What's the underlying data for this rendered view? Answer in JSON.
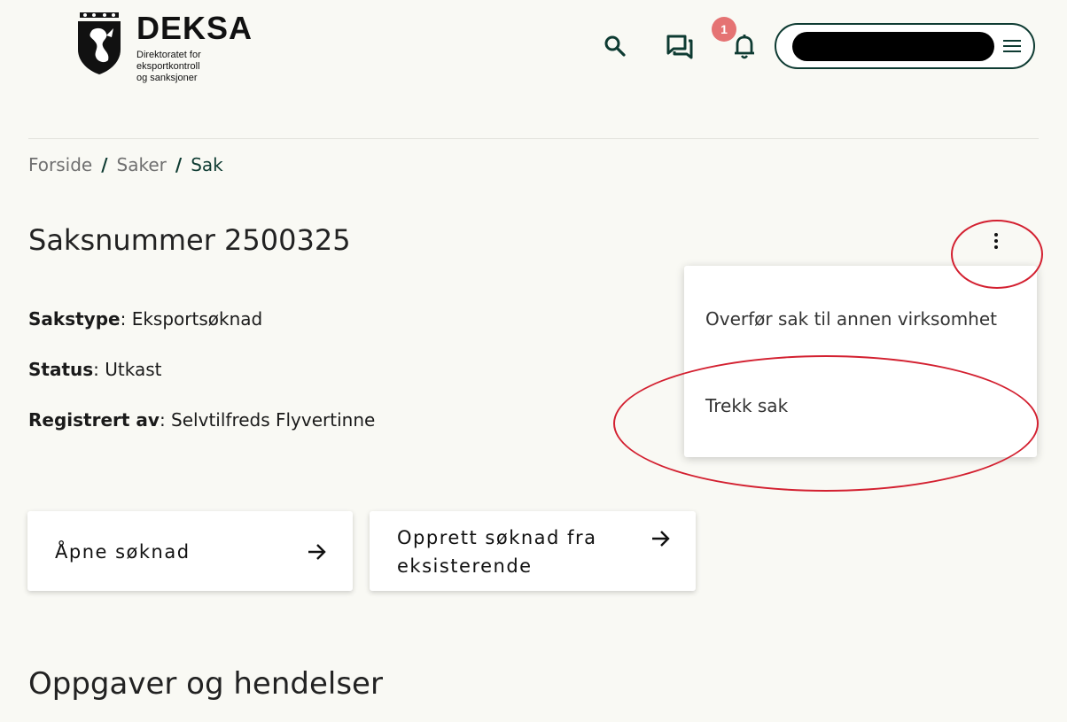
{
  "header": {
    "logo_name": "DEKSA",
    "logo_sub_line1": "Direktoratet for",
    "logo_sub_line2": "eksportkontroll",
    "logo_sub_line3": "og sanksjoner",
    "notification_count": "1",
    "icons": [
      "search-icon",
      "messages-icon",
      "bell-icon",
      "menu-icon"
    ],
    "accent_color": "#0e3b32",
    "badge_color": "#e57373"
  },
  "breadcrumb": {
    "items": [
      "Forside",
      "Saker",
      "Sak"
    ],
    "separator": "/"
  },
  "case": {
    "title": "Saksnummer 2500325",
    "type_label": "Sakstype",
    "type_value": ": Eksportsøknad",
    "status_label": "Status",
    "status_value": ": Utkast",
    "registered_label": "Registrert av",
    "registered_value": ": Selvtilfreds Flyvertinne"
  },
  "menu": {
    "items": [
      "Overfør sak til annen virksomhet",
      "Trekk sak"
    ]
  },
  "actions": {
    "open_label": "Åpne søknad",
    "create_line1": "Opprett søknad fra",
    "create_line2": "eksisterende"
  },
  "sections": {
    "tasks_title": "Oppgaver og hendelser"
  },
  "annotation_color": "#d32030"
}
